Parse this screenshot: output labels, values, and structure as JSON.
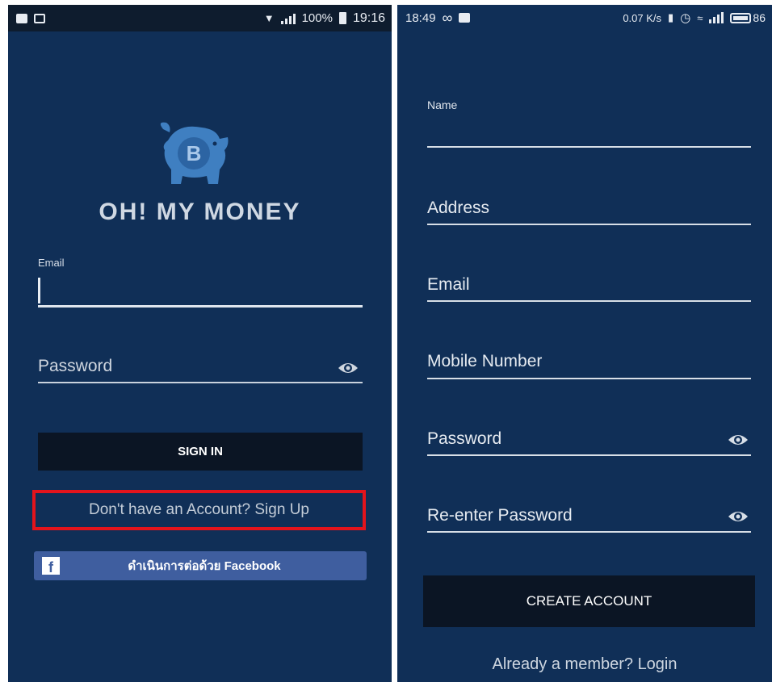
{
  "left_screen": {
    "status_bar": {
      "battery_percent": "100%",
      "time": "19:16"
    },
    "brand_name": "OH! MY MONEY",
    "logo_symbol": "B",
    "email_label": "Email",
    "password_placeholder": "Password",
    "sign_in_label": "SIGN IN",
    "signup_link": "Don't have an Account? Sign Up",
    "facebook_label": "ดำเนินการต่อด้วย Facebook",
    "facebook_icon_letter": "f"
  },
  "right_screen": {
    "status_bar": {
      "time": "18:49",
      "net_speed": "0.07 K/s",
      "battery_percent": "86"
    },
    "fields": {
      "name_label": "Name",
      "address": "Address",
      "email": "Email",
      "mobile": "Mobile Number",
      "password": "Password",
      "reenter_password": "Re-enter Password"
    },
    "create_account_label": "CREATE ACCOUNT",
    "login_link": "Already a member? Login"
  },
  "colors": {
    "background": "#102f57",
    "button_dark": "#0b1524",
    "highlight_red": "#e3141c",
    "facebook_blue": "#3f5e9f"
  }
}
